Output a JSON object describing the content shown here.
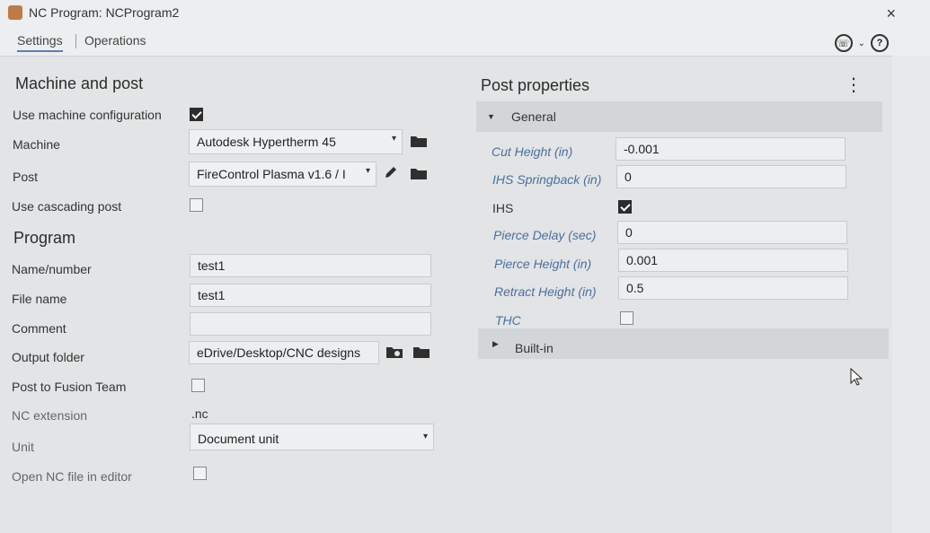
{
  "window": {
    "title": "NC Program: NCProgram2",
    "close_label": "×"
  },
  "tabs": [
    {
      "label": "Settings"
    },
    {
      "label": "Operations"
    }
  ],
  "header_icons": {
    "support_glyph": "☏",
    "chevron_glyph": "⌄",
    "help_glyph": "?"
  },
  "left": {
    "machine_section_title": "Machine and post",
    "use_machine_config_label": "Use machine configuration",
    "use_machine_config_checked": true,
    "machine_label": "Machine",
    "machine_value": "Autodesk Hypertherm 45",
    "post_label": "Post",
    "post_value": "FireControl Plasma v1.6 / I",
    "use_cascading_post_label": "Use cascading post",
    "use_cascading_post_checked": false,
    "program_section_title": "Program",
    "name_label": "Name/number",
    "name_value": "test1",
    "file_name_label": "File name",
    "file_name_value": "test1",
    "comment_label": "Comment",
    "comment_value": "",
    "output_folder_label": "Output folder",
    "output_folder_value": "eDrive/Desktop/CNC designs",
    "post_fusion_label": "Post to Fusion Team",
    "post_fusion_checked": false,
    "nc_extension_label": "NC extension",
    "nc_extension_value": ".nc",
    "unit_label": "Unit",
    "unit_value": "Document unit",
    "open_nc_label": "Open NC file in editor",
    "open_nc_checked": false
  },
  "right": {
    "section_title": "Post properties",
    "general_group": "General",
    "cut_height_label": "Cut Height (in)",
    "cut_height_value": "-0.001",
    "ihs_springback_label": "IHS Springback (in)",
    "ihs_springback_value": "0",
    "ihs_label": "IHS",
    "ihs_checked": true,
    "pierce_delay_label": "Pierce Delay (sec)",
    "pierce_delay_value": "0",
    "pierce_height_label": "Pierce Height (in)",
    "pierce_height_value": "0.001",
    "retract_height_label": "Retract Height (in)",
    "retract_height_value": "0.5",
    "thc_label": "THC",
    "thc_checked": false,
    "builtin_group": "Built-in"
  },
  "colors": {
    "accent": "#5a7fb5",
    "italic_label": "#4a6fa0",
    "group_bar": "#d3d6d8"
  }
}
